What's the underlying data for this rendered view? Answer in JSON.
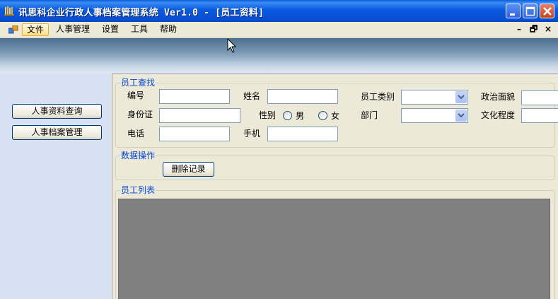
{
  "window": {
    "title": "讯思科企业行政人事档案管理系统 Ver1.0 - [员工资料]",
    "title_color": "#ffffff",
    "titlebar_color": "#0a5ae0"
  },
  "menu": {
    "items": [
      {
        "label": "文件"
      },
      {
        "label": "人事管理"
      },
      {
        "label": "设置"
      },
      {
        "label": "工具"
      },
      {
        "label": "帮助"
      }
    ],
    "mdi_controls": [
      "–",
      "🗗",
      "×"
    ]
  },
  "nav": {
    "buttons": [
      {
        "label": "人事资料查询"
      },
      {
        "label": "人事档案管理"
      }
    ]
  },
  "search": {
    "legend": "员工查找",
    "id_label": "编号",
    "name_label": "姓名",
    "category_label": "员工类别",
    "political_label": "政治面貌",
    "idcard_label": "身份证",
    "gender_label": "性别",
    "male_label": "男",
    "female_label": "女",
    "dept_label": "部门",
    "education_label": "文化程度",
    "phone_label": "电话",
    "mobile_label": "手机"
  },
  "ops": {
    "legend": "数据操作",
    "delete_label": "删除记录"
  },
  "list": {
    "legend": "员工列表"
  },
  "colors": {
    "legend_blue": "#0046d5",
    "nav_bg": "#d6e2f3",
    "grid_bg": "#808080"
  }
}
